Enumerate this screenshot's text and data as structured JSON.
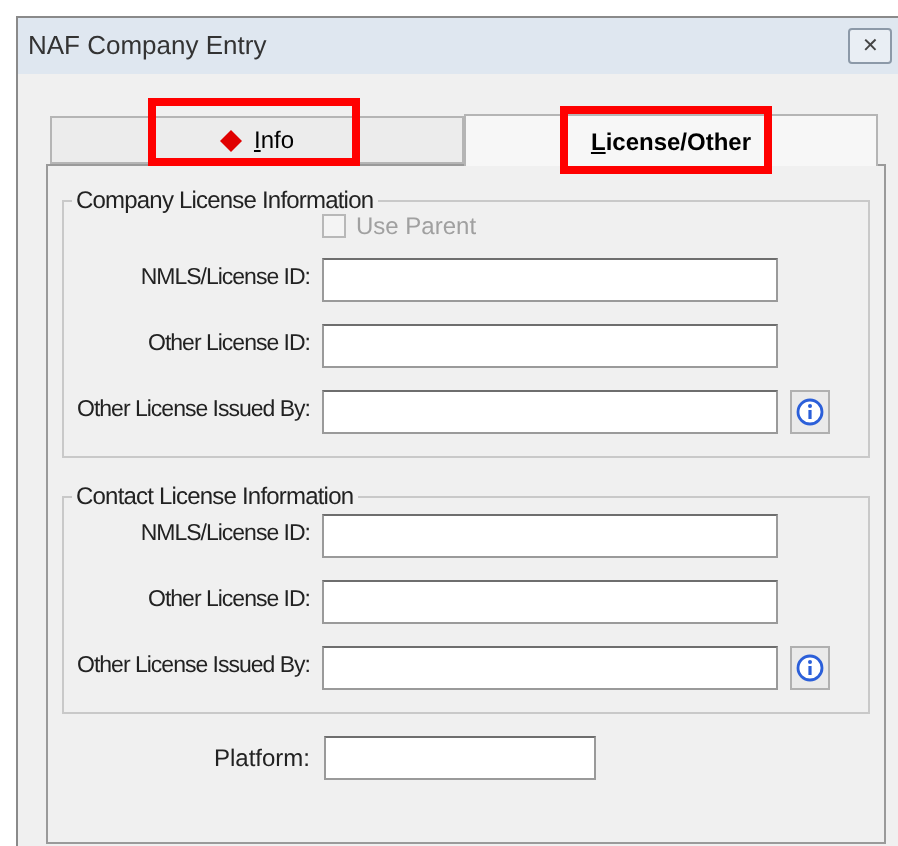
{
  "window": {
    "title": "NAF Company Entry",
    "close": "✕"
  },
  "tabs": [
    {
      "label": "Info",
      "selected": false,
      "highlighted": true,
      "error": true
    },
    {
      "label": "License/Other",
      "selected": true,
      "highlighted": true,
      "error": false
    }
  ],
  "groups": [
    {
      "title": "Company License Information",
      "use_parent": {
        "label": "Use Parent",
        "checked": false,
        "disabled": true
      },
      "fields": [
        {
          "label": "NMLS/License ID:",
          "info": false
        },
        {
          "label": "Other License ID:",
          "info": false
        },
        {
          "label": "Other License Issued By:",
          "info": true
        }
      ]
    },
    {
      "title": "Contact License Information",
      "fields": [
        {
          "label": "NMLS/License ID:",
          "info": false
        },
        {
          "label": "Other License ID:",
          "info": false
        },
        {
          "label": "Other License Issued By:",
          "info": true
        }
      ]
    }
  ],
  "platform": {
    "label": "Platform:"
  }
}
